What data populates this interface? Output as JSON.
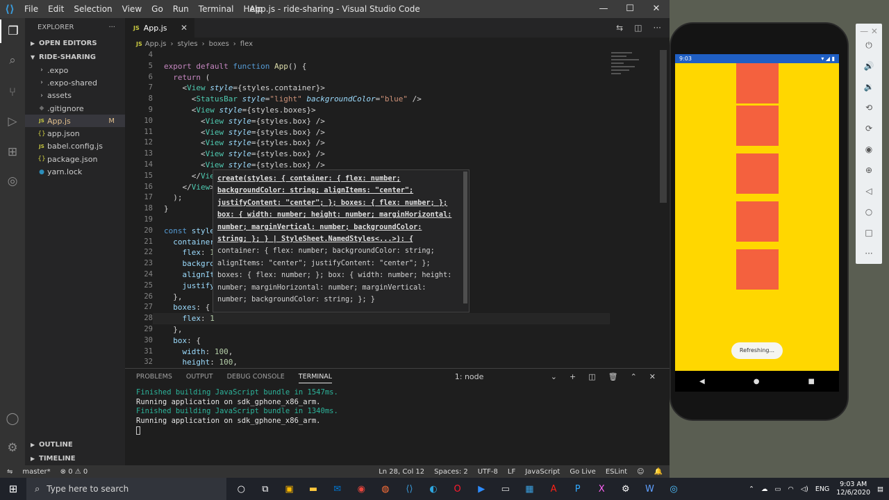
{
  "colors": {
    "activity_bg": "#333333",
    "sidebar_bg": "#252526",
    "editor_bg": "#1e1e1e",
    "app_yellow": "#ffd700",
    "box_orange": "#f4613e",
    "android_status": "#1f5fc4"
  },
  "titlebar": {
    "menus": [
      "File",
      "Edit",
      "Selection",
      "View",
      "Go",
      "Run",
      "Terminal",
      "Help"
    ],
    "title": "App.js - ride-sharing - Visual Studio Code"
  },
  "sidebar": {
    "title": "EXPLORER",
    "open_editors": "OPEN EDITORS",
    "project": "RIDE-SHARING",
    "items": [
      {
        "label": ".expo",
        "type": "folder"
      },
      {
        "label": ".expo-shared",
        "type": "folder"
      },
      {
        "label": "assets",
        "type": "folder"
      },
      {
        "label": ".gitignore",
        "type": "file"
      },
      {
        "label": "App.js",
        "type": "js",
        "badge": "M"
      },
      {
        "label": "app.json",
        "type": "json"
      },
      {
        "label": "babel.config.js",
        "type": "js"
      },
      {
        "label": "package.json",
        "type": "json"
      },
      {
        "label": "yarn.lock",
        "type": "file"
      }
    ],
    "outline": "OUTLINE",
    "timeline": "TIMELINE"
  },
  "tab": {
    "label": "App.js",
    "js": "JS"
  },
  "breadcrumb": [
    "App.js",
    "styles",
    "boxes",
    "flex"
  ],
  "editor": {
    "line_numbers": [
      4,
      5,
      6,
      7,
      8,
      9,
      10,
      11,
      12,
      13,
      14,
      15,
      16,
      17,
      18,
      19,
      20,
      21,
      22,
      23,
      24,
      25,
      26,
      27,
      28,
      29,
      30,
      31,
      32
    ],
    "hover_lines": [
      "create(styles: { container: { flex: number;",
      "backgroundColor: string; alignItems: \"center\";",
      "justifyContent: \"center\"; }; boxes: { flex: number; };",
      "box: { width: number; height: number; marginHorizontal:",
      "number; marginVertical: number; backgroundColor:",
      "string; }; } | StyleSheet.NamedStyles<...>): {",
      "container: { flex: number; backgroundColor: string;",
      "alignItems: \"center\"; justifyContent: \"center\"; };",
      "boxes: { flex: number; }; box: { width: number; height:",
      "number; marginHorizontal: number; marginVertical:",
      "number; backgroundColor: string; }; }"
    ]
  },
  "panel": {
    "tabs": [
      "PROBLEMS",
      "OUTPUT",
      "DEBUG CONSOLE",
      "TERMINAL"
    ],
    "terminal_select": "1: node",
    "lines": [
      {
        "text": "Finished building JavaScript bundle in 1547ms.",
        "color": "g"
      },
      {
        "text": "Running application on sdk_gphone_x86_arm.",
        "color": "w"
      },
      {
        "text": "Finished building JavaScript bundle in 1340ms.",
        "color": "g"
      },
      {
        "text": "Running application on sdk_gphone_x86_arm.",
        "color": "w"
      }
    ]
  },
  "statusbar": {
    "branch": "master*",
    "problems": "⊗ 0 ⚠ 0",
    "right": [
      "Ln 28, Col 12",
      "Spaces: 2",
      "UTF-8",
      "LF",
      "JavaScript",
      "Go Live",
      "ESLint"
    ]
  },
  "phone": {
    "time": "9:03",
    "refreshing": "Refreshing..."
  },
  "taskbar": {
    "search_placeholder": "Type here to search",
    "lang": "ENG",
    "time": "9:03 AM",
    "date": "12/6/2020"
  }
}
